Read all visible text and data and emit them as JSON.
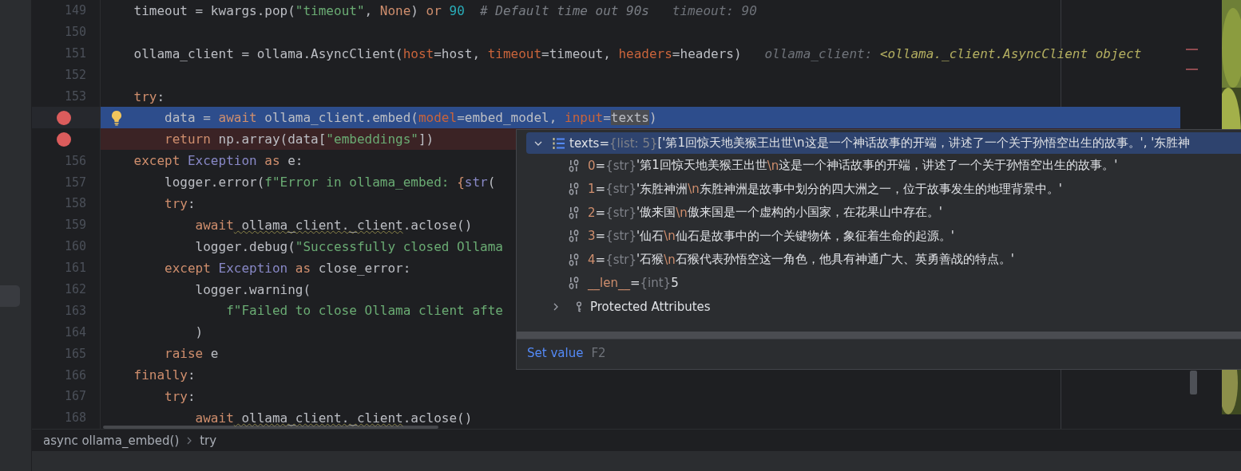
{
  "editor": {
    "lines": [
      {
        "number": "149",
        "breakpoint": false,
        "current": false,
        "intention_bulb": false,
        "tokens": [
          {
            "text": "    timeout = kwargs.pop(",
            "kind": "plain"
          },
          {
            "text": "\"timeout\"",
            "kind": "str"
          },
          {
            "text": ", ",
            "kind": "plain"
          },
          {
            "text": "None",
            "kind": "kw"
          },
          {
            "text": ") ",
            "kind": "plain"
          },
          {
            "text": "or",
            "kind": "kw"
          },
          {
            "text": " 90",
            "kind": "num"
          },
          {
            "text": "  # Default time out 90s",
            "kind": "comment"
          },
          {
            "text": "   timeout: 90",
            "kind": "hint"
          }
        ]
      },
      {
        "number": "150",
        "breakpoint": false,
        "current": false,
        "intention_bulb": false
      },
      {
        "number": "151",
        "breakpoint": false,
        "current": false,
        "intention_bulb": false,
        "tokens": [
          {
            "text": "    ollama_client = ollama.AsyncClient(",
            "kind": "plain"
          },
          {
            "text": "host",
            "kind": "param"
          },
          {
            "text": "=host, ",
            "kind": "plain"
          },
          {
            "text": "timeout",
            "kind": "param"
          },
          {
            "text": "=timeout, ",
            "kind": "plain"
          },
          {
            "text": "headers",
            "kind": "param"
          },
          {
            "text": "=headers)",
            "kind": "plain"
          },
          {
            "text": "   ollama_client: ",
            "kind": "hint"
          },
          {
            "text": "<ollama._client.AsyncClient object",
            "kind": "hintval"
          }
        ]
      },
      {
        "number": "152",
        "breakpoint": false,
        "current": false,
        "intention_bulb": false
      },
      {
        "number": "153",
        "breakpoint": false,
        "current": false,
        "intention_bulb": false,
        "tokens": [
          {
            "text": "    try",
            "kind": "kw"
          },
          {
            "text": ":",
            "kind": "plain"
          }
        ]
      },
      {
        "breakpoint": true,
        "current": true,
        "intention_bulb": true,
        "tokens": [
          {
            "text": "        data = ",
            "kind": "plain"
          },
          {
            "text": "await",
            "kind": "kw"
          },
          {
            "text": " ollama_client.embed(",
            "kind": "plain"
          },
          {
            "text": "model",
            "kind": "param"
          },
          {
            "text": "=embed_model, ",
            "kind": "plain"
          },
          {
            "text": "input",
            "kind": "param"
          },
          {
            "text": "=",
            "kind": "plain"
          },
          {
            "text": "texts",
            "kind": "usage"
          },
          {
            "text": ")",
            "kind": "plain"
          }
        ]
      },
      {
        "breakpoint": true,
        "current": false,
        "intention_bulb": false,
        "tokens": [
          {
            "text": "        return",
            "kind": "kw"
          },
          {
            "text": " np.array(data[",
            "kind": "plain"
          },
          {
            "text": "\"embeddings\"",
            "kind": "str"
          },
          {
            "text": "])",
            "kind": "plain"
          }
        ]
      },
      {
        "number": "156",
        "breakpoint": false,
        "current": false,
        "intention_bulb": false,
        "tokens": [
          {
            "text": "    except",
            "kind": "kw"
          },
          {
            "text": " Exception",
            "kind": "cls"
          },
          {
            "text": " as",
            "kind": "kw"
          },
          {
            "text": " e:",
            "kind": "plain"
          }
        ]
      },
      {
        "number": "157",
        "breakpoint": false,
        "current": false,
        "intention_bulb": false,
        "tokens": [
          {
            "text": "        logger.error(",
            "kind": "plain"
          },
          {
            "text": "f\"Error in ollama_embed: ",
            "kind": "str"
          },
          {
            "text": "{",
            "kind": "kw"
          },
          {
            "text": "str",
            "kind": "cls"
          },
          {
            "text": "(",
            "kind": "plain"
          }
        ]
      },
      {
        "number": "158",
        "breakpoint": false,
        "current": false,
        "intention_bulb": false,
        "tokens": [
          {
            "text": "        try",
            "kind": "kw"
          },
          {
            "text": ":",
            "kind": "plain"
          }
        ]
      },
      {
        "number": "159",
        "breakpoint": false,
        "current": false,
        "intention_bulb": false,
        "tokens": [
          {
            "text": "            await",
            "kind": "kw"
          },
          {
            "text": " ollama_client._client",
            "kind": "warn"
          },
          {
            "text": ".aclose()",
            "kind": "plain"
          }
        ]
      },
      {
        "number": "160",
        "breakpoint": false,
        "current": false,
        "intention_bulb": false,
        "tokens": [
          {
            "text": "            logger.debug(",
            "kind": "plain"
          },
          {
            "text": "\"Successfully closed Ollama",
            "kind": "str"
          }
        ]
      },
      {
        "number": "161",
        "breakpoint": false,
        "current": false,
        "intention_bulb": false,
        "tokens": [
          {
            "text": "        except",
            "kind": "kw"
          },
          {
            "text": " Exception",
            "kind": "cls"
          },
          {
            "text": " as",
            "kind": "kw"
          },
          {
            "text": " close_error:",
            "kind": "plain"
          }
        ]
      },
      {
        "number": "162",
        "breakpoint": false,
        "current": false,
        "intention_bulb": false,
        "tokens": [
          {
            "text": "            logger.warning(",
            "kind": "plain"
          }
        ]
      },
      {
        "number": "163",
        "breakpoint": false,
        "current": false,
        "intention_bulb": false,
        "tokens": [
          {
            "text": "                f\"Failed to close Ollama client afte",
            "kind": "str"
          }
        ]
      },
      {
        "number": "164",
        "breakpoint": false,
        "current": false,
        "intention_bulb": false,
        "tokens": [
          {
            "text": "            )",
            "kind": "plain"
          }
        ]
      },
      {
        "number": "165",
        "breakpoint": false,
        "current": false,
        "intention_bulb": false,
        "tokens": [
          {
            "text": "        raise",
            "kind": "kw"
          },
          {
            "text": " e",
            "kind": "plain"
          }
        ]
      },
      {
        "number": "166",
        "breakpoint": false,
        "current": false,
        "intention_bulb": false,
        "tokens": [
          {
            "text": "    finally",
            "kind": "kw"
          },
          {
            "text": ":",
            "kind": "plain"
          }
        ]
      },
      {
        "number": "167",
        "breakpoint": false,
        "current": false,
        "intention_bulb": false,
        "tokens": [
          {
            "text": "        try",
            "kind": "kw"
          },
          {
            "text": ":",
            "kind": "plain"
          }
        ]
      },
      {
        "number": "168",
        "breakpoint": false,
        "current": false,
        "intention_bulb": false,
        "tokens": [
          {
            "text": "            await",
            "kind": "kw"
          },
          {
            "text": " ollama_client._client",
            "kind": "warn"
          },
          {
            "text": ".aclose()",
            "kind": "plain"
          }
        ]
      }
    ]
  },
  "debug_popup": {
    "root": {
      "name": "texts",
      "operator": "=",
      "type": "{list: 5}",
      "value": "['第1回惊天地美猴王出世\\n这是一个神话故事的开端，讲述了一个关于孙悟空出生的故事。', '东胜神",
      "expanded": true,
      "selected": true
    },
    "children": [
      {
        "kind": "value",
        "name": "0",
        "operator": "=",
        "type": "{str}",
        "value": [
          {
            "text": "'第1回惊天地美猴王出世",
            "kind": "text"
          },
          {
            "text": "\\n",
            "kind": "escape"
          },
          {
            "text": "这是一个神话故事的开端，讲述了一个关于孙悟空出生的故事。'",
            "kind": "text"
          }
        ]
      },
      {
        "kind": "value",
        "name": "1",
        "operator": "=",
        "type": "{str}",
        "value": [
          {
            "text": "'东胜神洲",
            "kind": "text"
          },
          {
            "text": "\\n",
            "kind": "escape"
          },
          {
            "text": "东胜神洲是故事中划分的四大洲之一，位于故事发生的地理背景中。'",
            "kind": "text"
          }
        ]
      },
      {
        "kind": "value",
        "name": "2",
        "operator": "=",
        "type": "{str}",
        "value": [
          {
            "text": "'傲来国",
            "kind": "text"
          },
          {
            "text": "\\n",
            "kind": "escape"
          },
          {
            "text": "傲来国是一个虚构的小国家，在花果山中存在。'",
            "kind": "text"
          }
        ]
      },
      {
        "kind": "value",
        "name": "3",
        "operator": "=",
        "type": "{str}",
        "value": [
          {
            "text": "'仙石",
            "kind": "text"
          },
          {
            "text": "\\n",
            "kind": "escape"
          },
          {
            "text": "仙石是故事中的一个关键物体，象征着生命的起源。'",
            "kind": "text"
          }
        ]
      },
      {
        "kind": "value",
        "name": "4",
        "operator": "=",
        "type": "{str}",
        "value": [
          {
            "text": "'石猴",
            "kind": "text"
          },
          {
            "text": "\\n",
            "kind": "escape"
          },
          {
            "text": "石猴代表孙悟空这一角色，他具有神通广大、英勇善战的特点。'",
            "kind": "text"
          }
        ]
      },
      {
        "kind": "value",
        "name": "__len__",
        "operator": "=",
        "type": "{int}",
        "value": [
          {
            "text": "5",
            "kind": "text"
          }
        ]
      },
      {
        "kind": "group",
        "name": "Protected Attributes",
        "expanded": false
      }
    ],
    "footer": {
      "action": "Set value",
      "shortcut": "F2"
    }
  },
  "breadcrumb": [
    "async ollama_embed()",
    "try"
  ]
}
